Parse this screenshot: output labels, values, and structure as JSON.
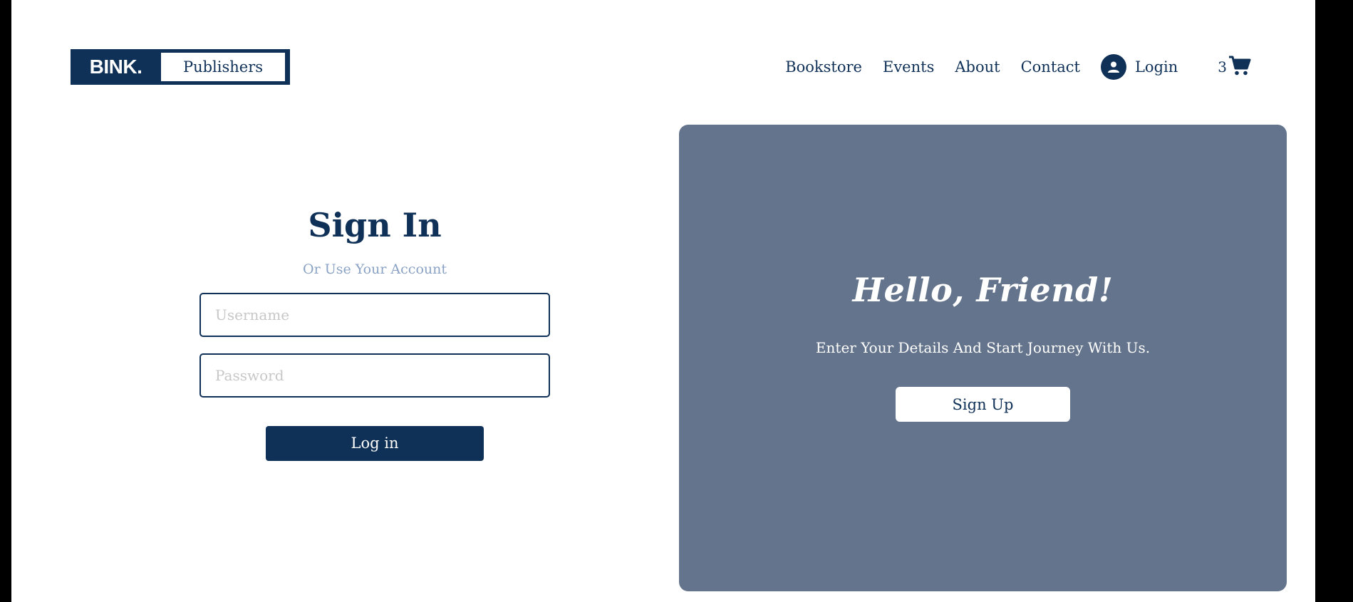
{
  "header": {
    "logo_text": "BINK.",
    "logo_sub": "Publishers",
    "nav": [
      {
        "label": "Bookstore"
      },
      {
        "label": "Events"
      },
      {
        "label": "About"
      },
      {
        "label": "Contact"
      }
    ],
    "login_label": "Login",
    "cart_count": "3",
    "icons": {
      "user": "user-circle-icon",
      "cart": "shopping-cart-icon"
    }
  },
  "signin": {
    "title": "Sign In",
    "subtitle": "Or Use Your Account",
    "username_placeholder": "Username",
    "password_placeholder": "Password",
    "login_button": "Log in"
  },
  "panel": {
    "title": "Hello, Friend!",
    "text": "Enter Your Details And Start Journey With Us.",
    "signup_button": "Sign Up"
  },
  "colors": {
    "primary": "#0f3057",
    "panel": "#64748c",
    "subtitle": "#8aa2c4"
  }
}
